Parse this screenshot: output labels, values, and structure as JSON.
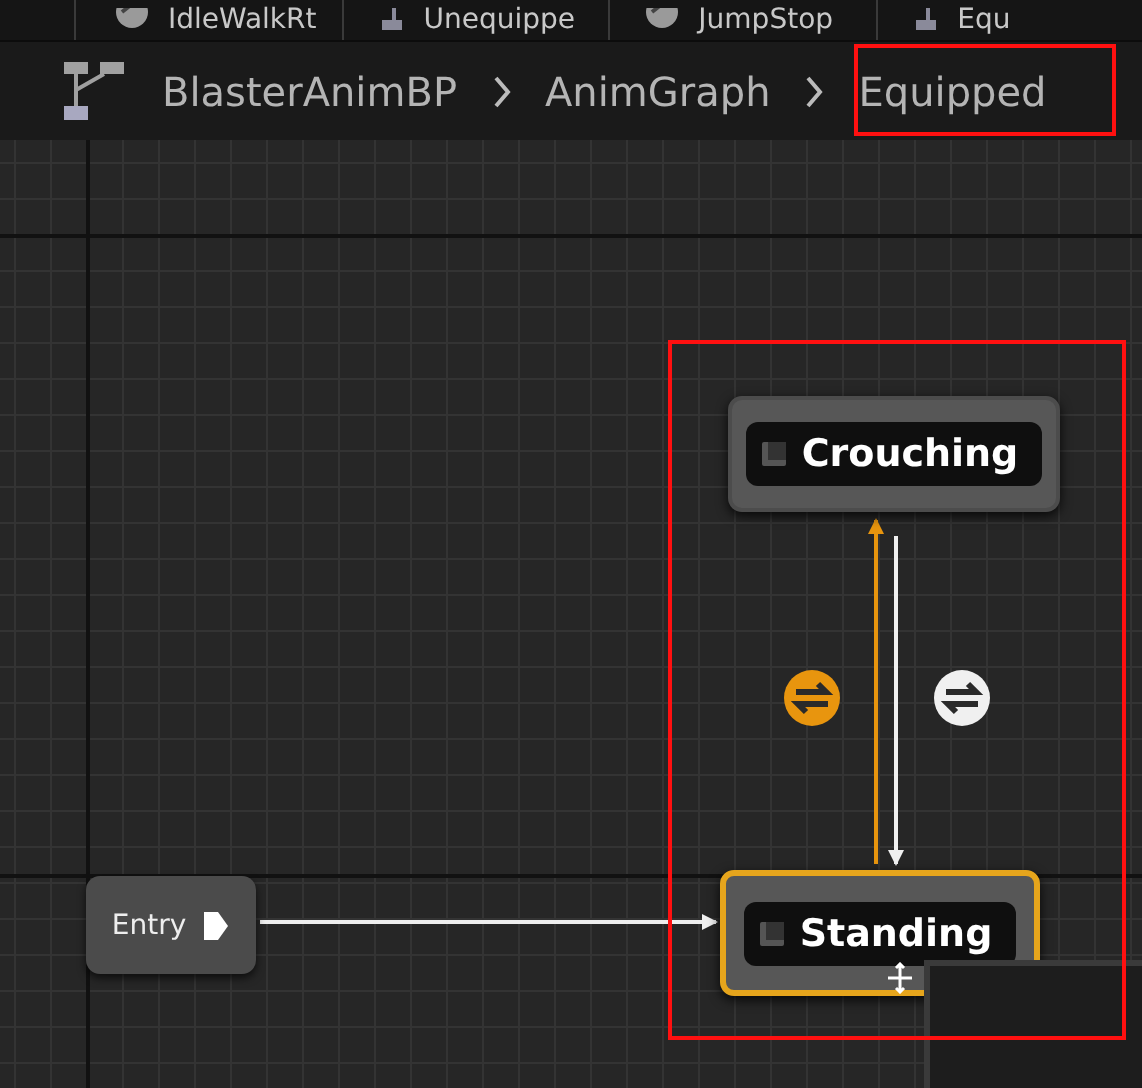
{
  "tabs": [
    {
      "label": "IdleWalkRt",
      "kind": "sequence"
    },
    {
      "label": "Unequippe",
      "kind": "state"
    },
    {
      "label": "JumpStop",
      "kind": "sequence"
    },
    {
      "label": "Equ",
      "kind": "state"
    }
  ],
  "breadcrumb": [
    "BlasterAnimBP",
    "AnimGraph",
    "Equipped"
  ],
  "entry": {
    "label": "Entry"
  },
  "states": [
    {
      "name": "Crouching",
      "selected": false
    },
    {
      "name": "Standing",
      "selected": true
    }
  ],
  "transitions": [
    {
      "color": "#e8950e"
    },
    {
      "color": "#f0f0f0"
    }
  ]
}
